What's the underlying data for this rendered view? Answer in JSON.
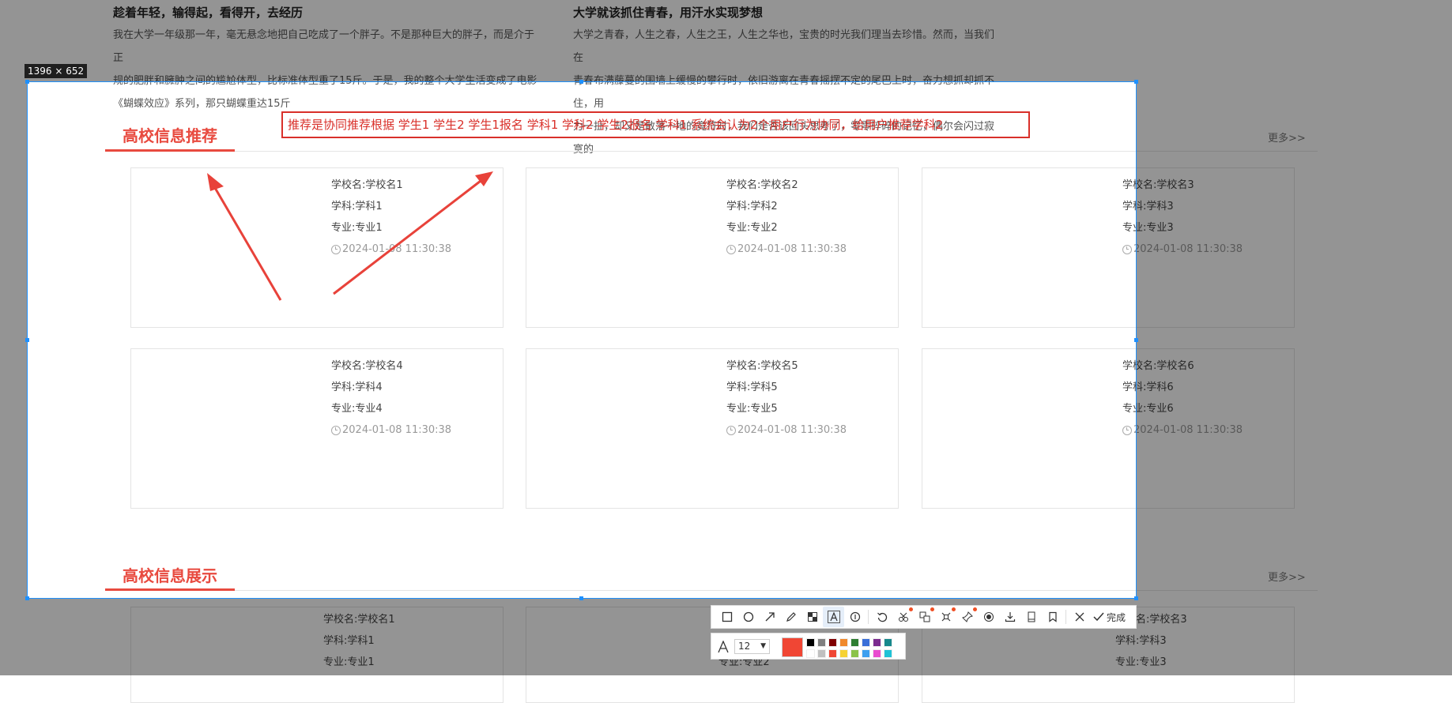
{
  "articles": [
    {
      "title": "趁着年轻，输得起，看得开，去经历",
      "lines": [
        "我在大学一年级那一年，毫无悬念地把自己吃成了一个胖子。不是那种巨大的胖子，而是介于正",
        "规的肥胖和臃肿之间的尴尬体型，比标准体型重了15斤。于是，我的整个大学生活变成了电影",
        "《蝴蝶效应》系列，那只蝴蝶重达15斤"
      ]
    },
    {
      "title": "大学就该抓住青春，用汗水实现梦想",
      "lines": [
        "大学之青春，人生之春，人生之王，人生之华也，宝贵的时光我们理当去珍惜。然而，当我们在",
        "青春布满藤蔓的围墙上缓慢的攀行时，依旧游离在青春摇摆不定的尾巴上时，奋力想抓却抓不住，用",
        "力一扯，却又是散落一地的竟符时，我们是否该回头思考了，零零碎碎的记忆，偶尔会闪过寂寞的"
      ]
    }
  ],
  "selection_size": "1396 × 652",
  "annotation_text": "推荐是协同推荐根据 学生1 学生2 学生1报名 学科1 学科2 学生2报名 学科1   系统会认为2个用户行为协同，给用户推荐学科2",
  "sections": [
    {
      "title": "高校信息推荐",
      "more": "更多>>"
    },
    {
      "title": "高校信息展示",
      "more": "更多>>"
    }
  ],
  "cards": [
    {
      "school": "学校名:学校名1",
      "subject": "学科:学科1",
      "major": "专业:专业1",
      "time": "2024-01-08 11:30:38"
    },
    {
      "school": "学校名:学校名2",
      "subject": "学科:学科2",
      "major": "专业:专业2",
      "time": "2024-01-08 11:30:38"
    },
    {
      "school": "学校名:学校名3",
      "subject": "学科:学科3",
      "major": "专业:专业3",
      "time": "2024-01-08 11:30:38"
    },
    {
      "school": "学校名:学校名4",
      "subject": "学科:学科4",
      "major": "专业:专业4",
      "time": "2024-01-08 11:30:38"
    },
    {
      "school": "学校名:学校名5",
      "subject": "学科:学科5",
      "major": "专业:专业5",
      "time": "2024-01-08 11:30:38"
    },
    {
      "school": "学校名:学校名6",
      "subject": "学科:学科6",
      "major": "专业:专业6",
      "time": "2024-01-08 11:30:38"
    }
  ],
  "bottom_cards": [
    {
      "school": "学校名:学校名1",
      "subject": "学科:学科1",
      "major": "专业:专业1"
    },
    {
      "school": "",
      "subject": "",
      "major": "专业:专业2"
    },
    {
      "school": "学校名:学校名3",
      "subject": "学科:学科3",
      "major": "专业:专业3"
    }
  ],
  "toolbar": {
    "tools": [
      "rectangle-icon",
      "circle-icon",
      "arrow-icon",
      "pencil-icon",
      "mosaic-icon",
      "text-icon",
      "number-marker-icon",
      "undo-icon",
      "ocr-icon",
      "translate-icon",
      "scissors-icon",
      "pin-icon",
      "record-icon",
      "download-icon",
      "long-screenshot-icon",
      "bookmark-icon",
      "close-icon"
    ],
    "done_label": "完成"
  },
  "palette": {
    "font_size": "12",
    "current_color": "#f04634",
    "colors_row1": [
      "#000000",
      "#808080",
      "#800000",
      "#f0892c",
      "#2e7d32",
      "#3a6fd8",
      "#7b2b8f",
      "#17888c"
    ],
    "colors_row2": [
      "#ffffff",
      "#c0c0c0",
      "#f04634",
      "#f6d233",
      "#8bc34a",
      "#3ea0f0",
      "#e94ccf",
      "#1fc2d6"
    ]
  },
  "colors": {
    "accent": "#e84a3f",
    "selection": "#1e90ff"
  }
}
